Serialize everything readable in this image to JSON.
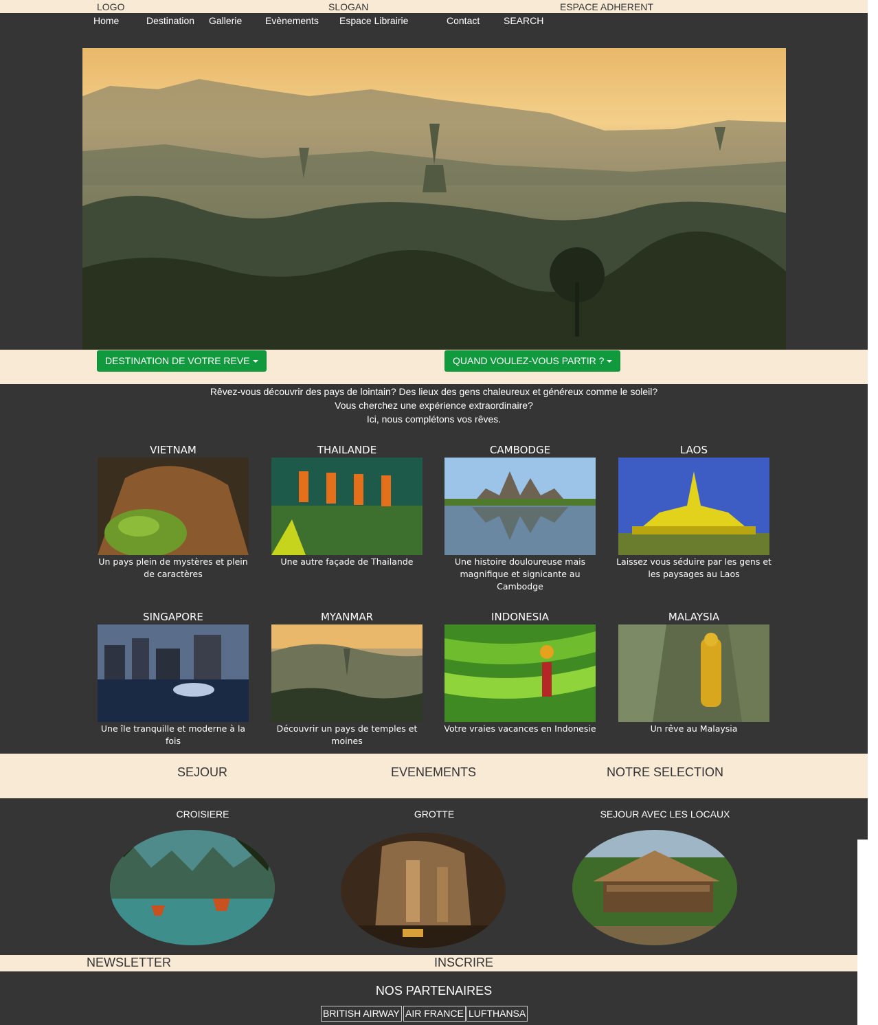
{
  "topbar": {
    "logo": "LOGO",
    "slogan": "SLOGAN",
    "member": "ESPACE ADHERENT"
  },
  "nav": {
    "home": "Home",
    "destination": "Destination",
    "gallery": "Gallerie",
    "events": "Evènements",
    "library": "Espace Librairie",
    "contact": "Contact",
    "search": "SEARCH"
  },
  "filters": {
    "destination": "DESTINATION DE VOTRE REVE",
    "when": "QUAND VOULEZ-VOUS PARTIR ?"
  },
  "intro": {
    "line1": "Rêvez-vous découvrir des pays de lointain? Des lieux des gens chaleureux et généreux comme le soleil?",
    "line2": "Vous cherchez une expérience extraordinaire?",
    "line3": "Ici, nous complétons vos rêves."
  },
  "destinations": [
    {
      "name": "VIETNAM",
      "desc": "Un pays plein de mystères et plein de caractères"
    },
    {
      "name": "THAILANDE",
      "desc": "Une autre façade de Thailande"
    },
    {
      "name": "CAMBODGE",
      "desc": "Une histoire douloureuse mais magnifique et signicante au Cambodge"
    },
    {
      "name": "LAOS",
      "desc": "Laissez vous séduire par les gens et les paysages au Laos"
    },
    {
      "name": "SINGAPORE",
      "desc": "Une île tranquille et moderne à la fois"
    },
    {
      "name": "MYANMAR",
      "desc": "Découvrir un pays de temples et moines"
    },
    {
      "name": "INDONESIA",
      "desc": "Votre vraies vacances en Indonesie"
    },
    {
      "name": "MALAYSIA",
      "desc": "Un rêve au Malaysia"
    }
  ],
  "sections": {
    "sejour": "SEJOUR",
    "events": "EVENEMENTS",
    "selection": "NOTRE SELECTION"
  },
  "selection": [
    {
      "title": "CROISIERE"
    },
    {
      "title": "GROTTE"
    },
    {
      "title": "SEJOUR AVEC LES LOCAUX"
    }
  ],
  "newsletter": {
    "label": "NEWSLETTER",
    "subscribe": "INSCRIRE"
  },
  "partners": {
    "title": "NOS PARTENAIRES",
    "items": [
      "BRITISH AIRWAY",
      "AIR FRANCE",
      "LUFTHANSA"
    ]
  },
  "colors": {
    "background": "#353535",
    "band": "#f9ead6",
    "button": "#109a3d"
  }
}
